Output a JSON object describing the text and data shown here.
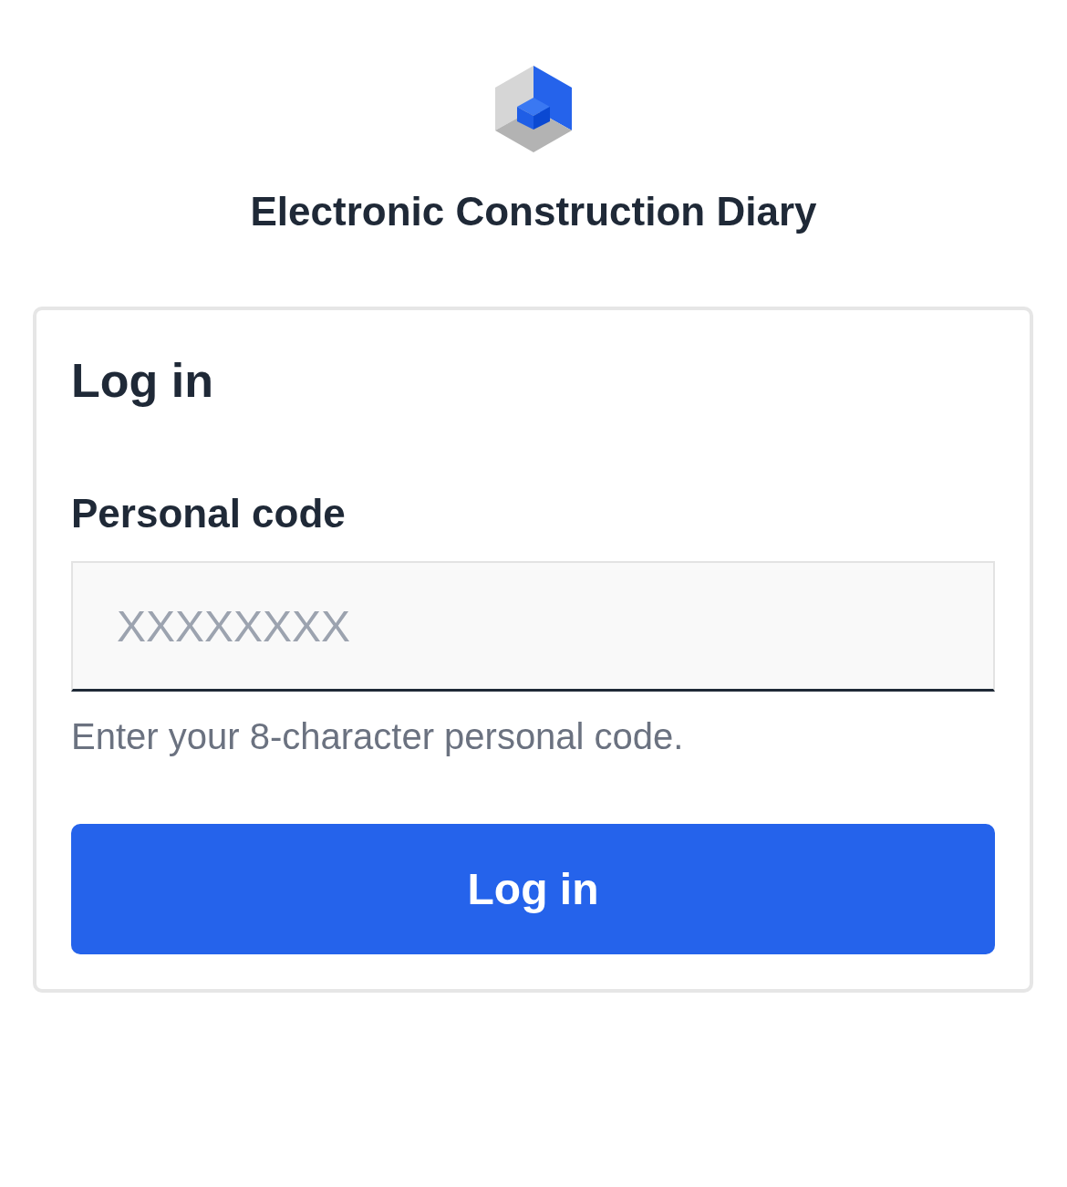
{
  "header": {
    "title": "Electronic Construction Diary"
  },
  "login_card": {
    "heading": "Log in",
    "personal_code_field": {
      "label": "Personal code",
      "placeholder": "XXXXXXXX",
      "hint": "Enter your 8-character personal code."
    },
    "button": "Log in"
  }
}
